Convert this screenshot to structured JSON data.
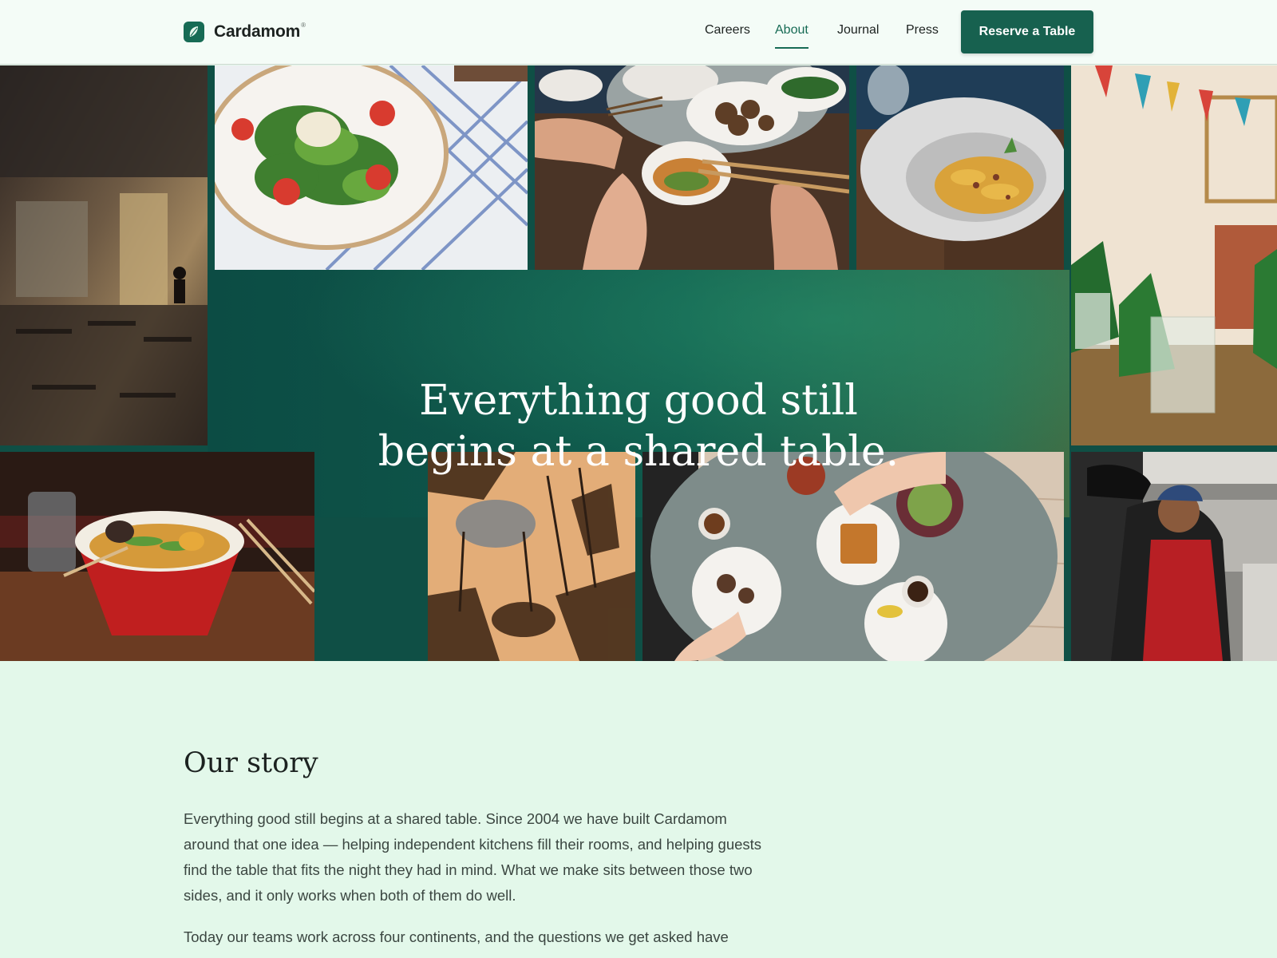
{
  "header": {
    "brand": "Cardamom",
    "brand_mark": "®",
    "nav": [
      {
        "label": "Careers",
        "active": false
      },
      {
        "label": "About",
        "active": true
      },
      {
        "label": "Journal",
        "active": false
      },
      {
        "label": "Press",
        "active": false
      }
    ],
    "cta_label": "Reserve a Table"
  },
  "hero": {
    "title_line1": "Everything good still",
    "title_line2": "begins at a shared table."
  },
  "story": {
    "heading": "Our story",
    "paragraph1": "Everything good still begins at a shared table. Since 2004 we have built Cardamom around that one idea — helping independent kitchens fill their rooms, and helping guests find the table that fits the night they had in mind. What we make sits between those two sides, and it only works when both of them do well.",
    "paragraph2": "Today our teams work across four continents, and the questions we get asked have"
  },
  "icons": {
    "logo": "leaf-icon"
  },
  "colors": {
    "brand_green": "#17614f",
    "active_nav": "#176b55",
    "page_bg": "#e3f8ea",
    "header_bg": "#f4fcf7"
  }
}
